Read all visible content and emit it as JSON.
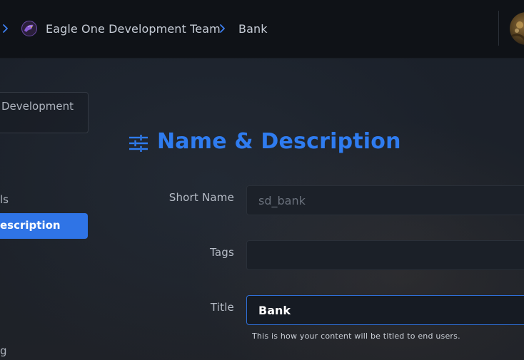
{
  "breadcrumb": {
    "org_name": "Eagle One Development Team",
    "current": "Bank"
  },
  "sidebar": {
    "org_card_text": "Development",
    "items": [
      {
        "label": "ls"
      },
      {
        "label": "escription",
        "active": true
      },
      {
        "label": "g"
      }
    ]
  },
  "section": {
    "title": "Name & Description",
    "icon": "sliders-icon"
  },
  "form": {
    "short_name": {
      "label": "Short Name",
      "value": "sd_bank"
    },
    "tags": {
      "label": "Tags",
      "value": ""
    },
    "title": {
      "label": "Title",
      "value": "Bank",
      "help": "This is how your content will be titled to end users."
    }
  },
  "colors": {
    "accent": "#2f74e6",
    "title_blue": "#2f7cf0",
    "topbar_bg": "#0f1217"
  }
}
